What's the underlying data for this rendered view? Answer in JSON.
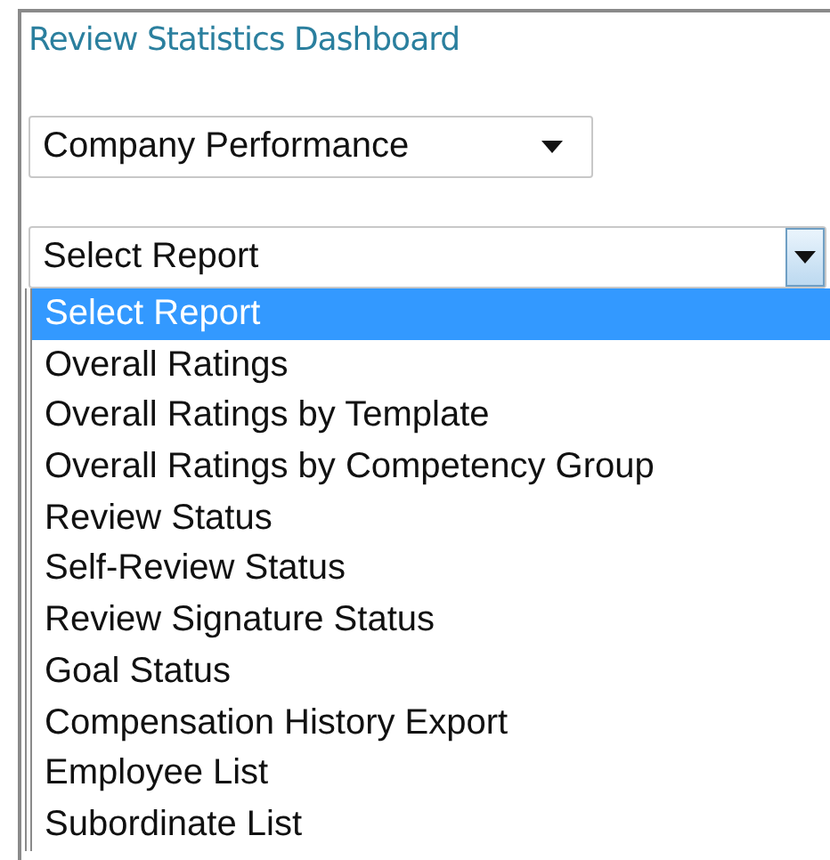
{
  "title": "Review Statistics Dashboard",
  "category_select": {
    "value": "Company Performance"
  },
  "report_select": {
    "value": "Select Report",
    "expanded": true,
    "options": [
      {
        "label": "Select Report",
        "selected": true
      },
      {
        "label": "Overall Ratings",
        "selected": false
      },
      {
        "label": "Overall Ratings by Template",
        "selected": false
      },
      {
        "label": "Overall Ratings by Competency Group",
        "selected": false
      },
      {
        "label": "Review Status",
        "selected": false
      },
      {
        "label": "Self-Review Status",
        "selected": false
      },
      {
        "label": "Review Signature Status",
        "selected": false
      },
      {
        "label": "Goal Status",
        "selected": false
      },
      {
        "label": "Compensation History Export",
        "selected": false
      },
      {
        "label": "Employee List",
        "selected": false
      },
      {
        "label": "Subordinate List",
        "selected": false
      }
    ]
  }
}
